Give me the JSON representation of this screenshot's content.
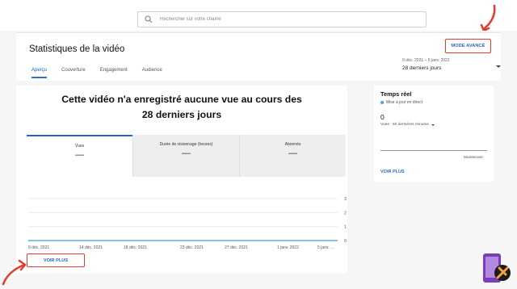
{
  "search": {
    "placeholder": "Rechercher sur votre chaîne"
  },
  "header": {
    "title": "Statistiques de la vidéo",
    "mode_button": "MODE AVANCÉ",
    "tabs": [
      {
        "label": "Aperçu",
        "active": true
      },
      {
        "label": "Couverture"
      },
      {
        "label": "Engagement"
      },
      {
        "label": "Audience"
      }
    ],
    "date_range": "9 déc. 2021 – 5 janv. 2022",
    "date_label": "28 derniers jours"
  },
  "main": {
    "headline_line1": "Cette vidéo n'a enregistré aucune vue au cours des",
    "headline_line2": "28 derniers jours",
    "metrics": [
      {
        "label": "Vues",
        "value": "—"
      },
      {
        "label": "Durée de visionnage (heures)",
        "value": "—"
      },
      {
        "label": "Abonnés",
        "value": "—"
      }
    ],
    "voir_plus": "VOIR PLUS"
  },
  "chart_data": {
    "type": "line",
    "x": [
      "9 déc. 2021",
      "14 déc. 2021",
      "18 déc. 2021",
      "23 déc. 2021",
      "27 déc. 2021",
      "1 janv. 2022",
      "5 janv. ..."
    ],
    "series": [
      {
        "values": [
          0,
          0,
          0,
          0,
          0,
          0,
          0
        ]
      }
    ],
    "yticks": [
      "3",
      "2",
      "1",
      "0"
    ],
    "ylim": [
      0,
      3
    ],
    "grid": true,
    "series_color": "#5ab0d8"
  },
  "realtime": {
    "title": "Temps réel",
    "live": "Mise à jour en direct",
    "count": "0",
    "views_label": "Vues · 60 dernières minutes",
    "now": "Maintenant",
    "voir_plus": "VOIR PLUS"
  },
  "colors": {
    "accent": "#2f66c8",
    "highlight": "#e53a2f",
    "tab_underline": "#3a6fd0",
    "live_dot": "#3fa8e0"
  }
}
